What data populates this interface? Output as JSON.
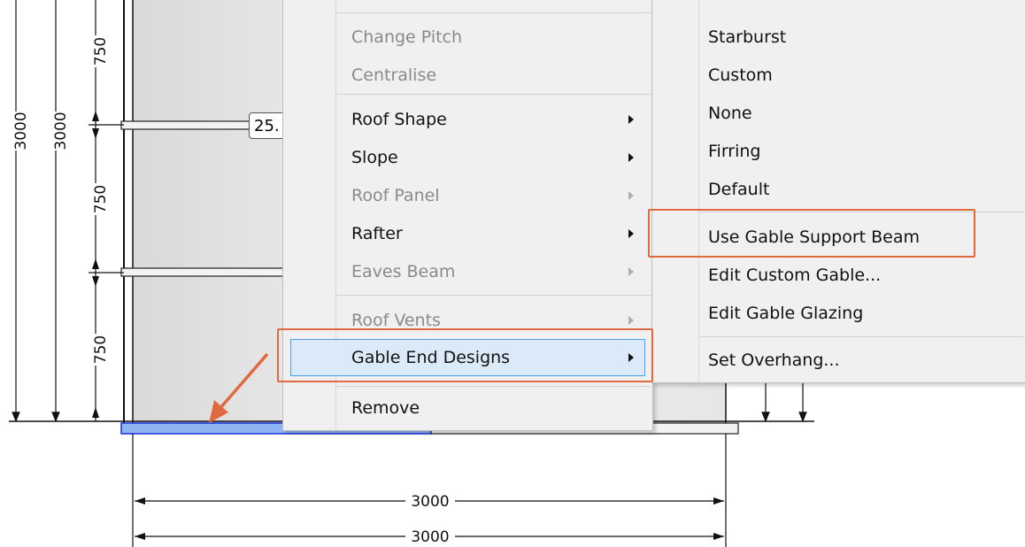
{
  "drawing": {
    "vertical_dims": [
      "3000",
      "3000",
      "750",
      "750",
      "750"
    ],
    "horizontal_dims": [
      "3000",
      "3000"
    ],
    "tag_text": "25."
  },
  "context_menu": {
    "items": [
      {
        "label": "Change Pitch",
        "enabled": false,
        "submenu": false
      },
      {
        "label": "Centralise",
        "enabled": false,
        "submenu": false
      },
      {
        "label": "Roof Shape",
        "enabled": true,
        "submenu": true
      },
      {
        "label": "Slope",
        "enabled": true,
        "submenu": true
      },
      {
        "label": "Roof Panel",
        "enabled": false,
        "submenu": true
      },
      {
        "label": "Rafter",
        "enabled": true,
        "submenu": true
      },
      {
        "label": "Eaves Beam",
        "enabled": false,
        "submenu": true
      },
      {
        "label": "Roof Vents",
        "enabled": false,
        "submenu": true
      },
      {
        "label": "Gable End Designs",
        "enabled": true,
        "submenu": true,
        "highlighted": true
      },
      {
        "label": "Remove",
        "enabled": true,
        "submenu": false
      }
    ]
  },
  "submenu": {
    "items": [
      {
        "label": "Starburst"
      },
      {
        "label": "Custom"
      },
      {
        "label": "None"
      },
      {
        "label": "Firring"
      },
      {
        "label": "Default"
      },
      {
        "label": "Use Gable Support Beam",
        "callout": true
      },
      {
        "label": "Edit Custom Gable..."
      },
      {
        "label": "Edit Gable Glazing"
      },
      {
        "label": "Set Overhang..."
      }
    ]
  },
  "colors": {
    "callout": "#e06a40",
    "menu_highlight": "#dbeaf9",
    "menu_highlight_border": "#49a0e8",
    "selected_beam": "#8fb6f2"
  }
}
